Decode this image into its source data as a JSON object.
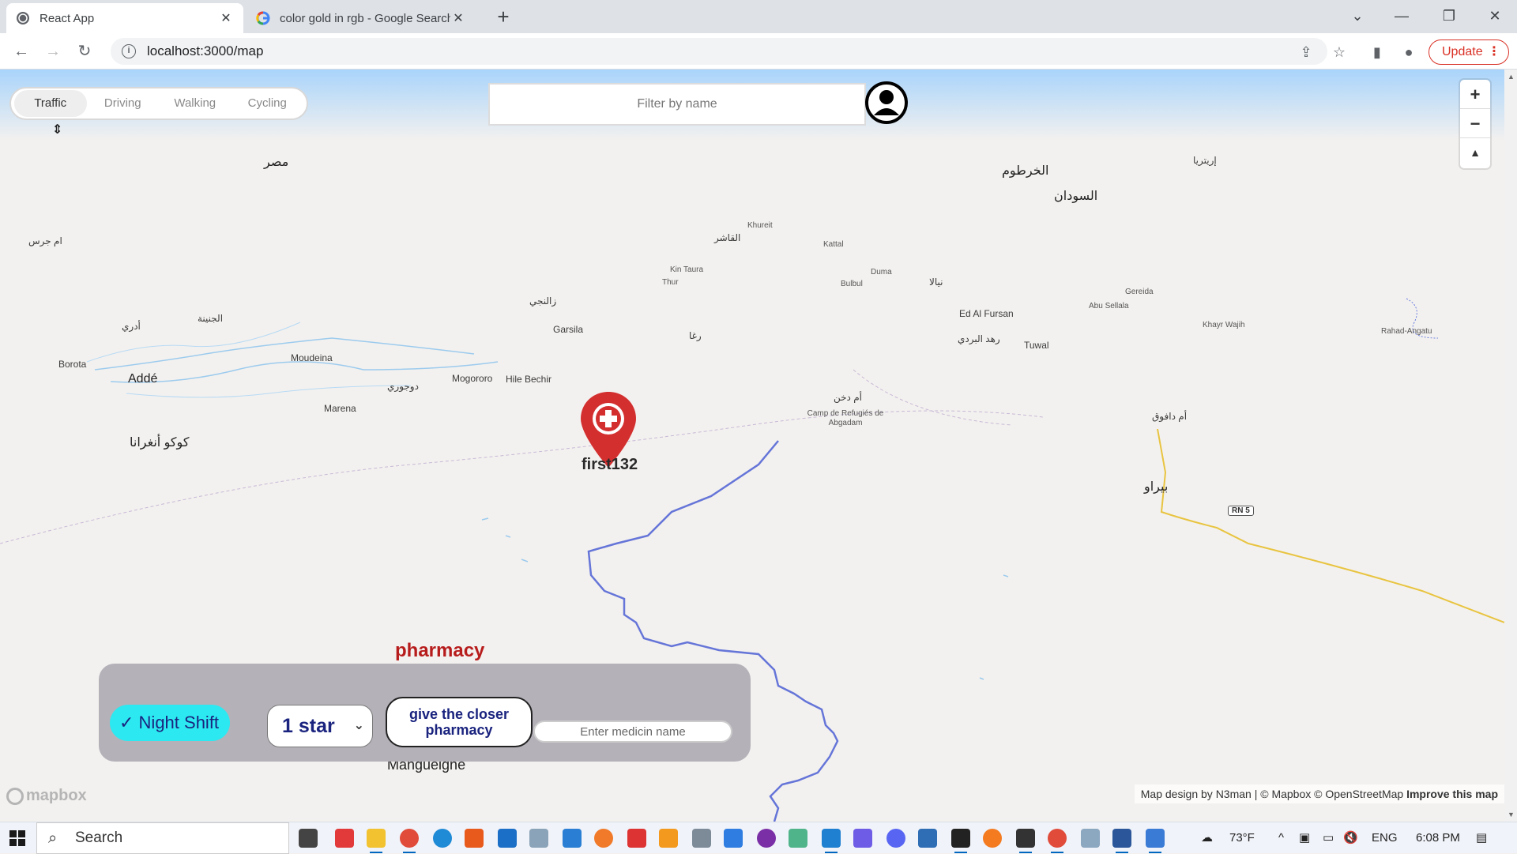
{
  "browser": {
    "tabs": [
      {
        "title": "React App",
        "active": true
      },
      {
        "title": "color gold in rgb - Google Search",
        "active": false
      }
    ],
    "url": "localhost:3000/map",
    "update_label": "Update"
  },
  "map": {
    "travel_modes": [
      "Traffic",
      "Driving",
      "Walking",
      "Cycling"
    ],
    "active_mode": "Traffic",
    "filter_placeholder": "Filter by name",
    "marker_label": "first132",
    "place_labels": [
      "مصر",
      "الخرطوم",
      "السودان",
      "إريتريا",
      "ام جرس",
      "Borota",
      "Addé",
      "أدري",
      "الجنينة",
      "Moudeina",
      "Mogororo",
      "Hile Bechir",
      "Marena",
      "دوجوري",
      "كوكو أنغرانا",
      "Garsila",
      "زالنجي",
      "Kin Taura",
      "Thur",
      "Khureit",
      "Kattal",
      "Duma",
      "Bulbul",
      "نيالا",
      "Ed Al Fursan",
      "رهد البردي",
      "Tuwal",
      "Gereida",
      "Abu Sellala",
      "Khayr Wajih",
      "Rahad-Angatu",
      "Camp de Refugiés de Abgadam",
      "أم دخن",
      "أم دافوق",
      "بيراو",
      "RN 5",
      "Mangueigne",
      "رغا",
      "القاشر",
      "أم دخن"
    ],
    "zoom_in": "+",
    "zoom_out": "−",
    "compass": "▲",
    "logo_text": "mapbox",
    "attribution": "Map design by N3man | © Mapbox © OpenStreetMap",
    "improve_link": "Improve this map"
  },
  "panel": {
    "title": "pharmacy",
    "night_shift_label": "✓ Night Shift",
    "rating_value": "1 star",
    "closer_button": "give the closer pharmacy",
    "medicine_placeholder": "Enter medicin name"
  },
  "taskbar": {
    "search_label": "Search",
    "weather": "73°F",
    "language": "ENG",
    "time": "6:08 PM"
  },
  "colors": {
    "accent_red": "#d93025",
    "night_shift_bg": "#2ce8f0",
    "panel_bg": "#b5b1b9",
    "marker_red": "#d32f2f",
    "panel_title": "#b71c1c"
  }
}
